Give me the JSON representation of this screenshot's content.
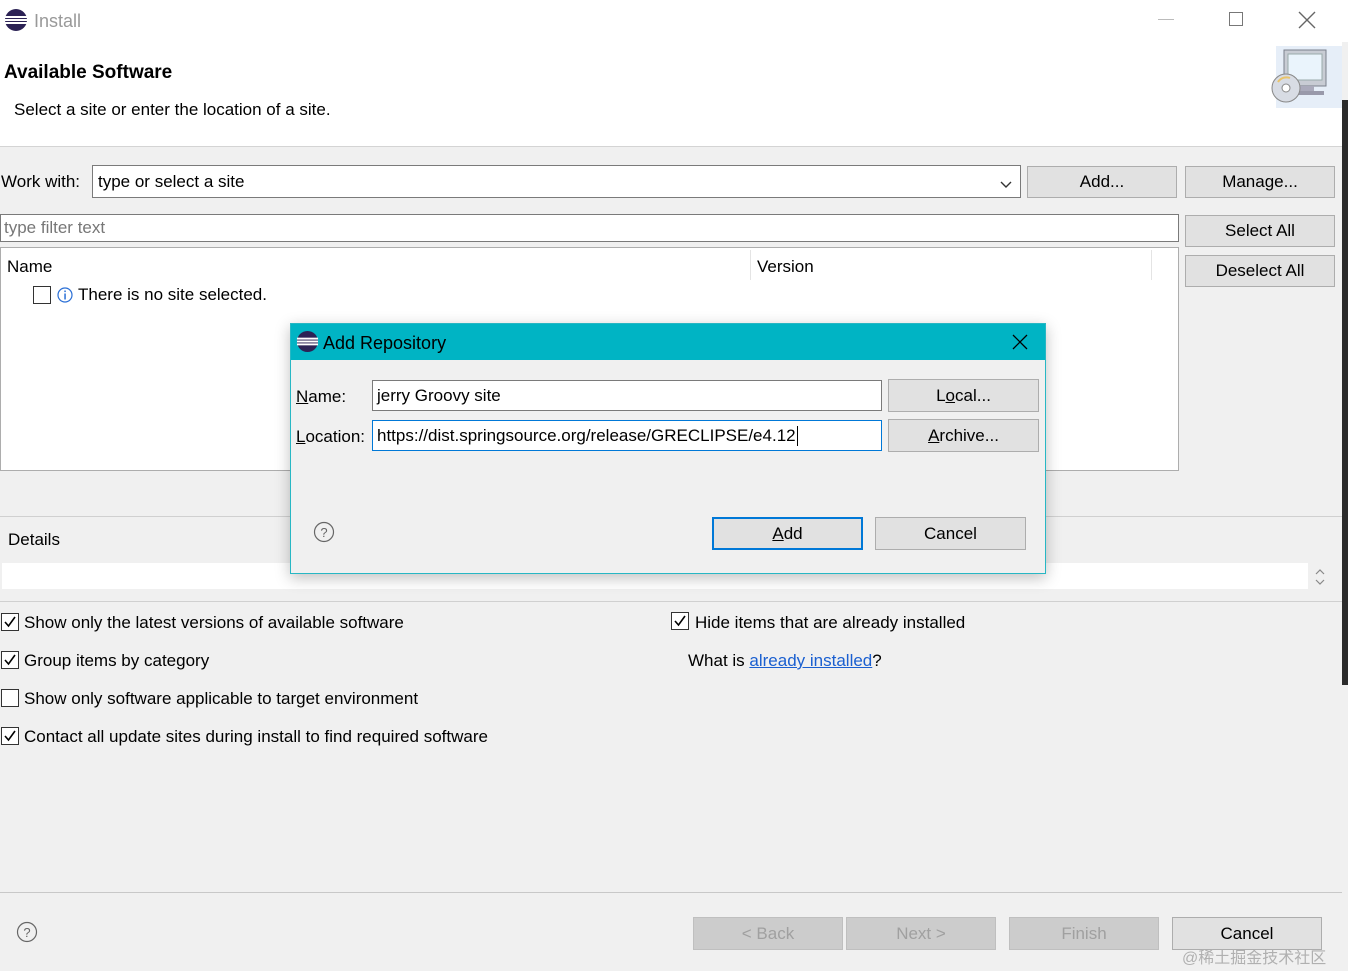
{
  "window": {
    "title": "Install"
  },
  "header": {
    "title": "Available Software",
    "subtitle": "Select a site or enter the location of a site."
  },
  "work_with": {
    "label": "Work with:",
    "placeholder": "type or select a site",
    "add_button": "Add...",
    "manage_button": "Manage..."
  },
  "filter": {
    "placeholder": "type filter text"
  },
  "side_buttons": {
    "select_all": "Select All",
    "deselect_all": "Deselect All"
  },
  "table": {
    "columns": [
      "Name",
      "Version"
    ],
    "rows": [
      {
        "checked": false,
        "text": "There is no site selected."
      }
    ]
  },
  "details": {
    "label": "Details"
  },
  "options": {
    "show_latest": {
      "label": "Show only the latest versions of available software",
      "checked": true
    },
    "group_by_category": {
      "label": "Group items by category",
      "checked": true
    },
    "show_applicable": {
      "label": "Show only software applicable to target environment",
      "checked": false
    },
    "contact_all": {
      "label": "Contact all update sites during install to find required software",
      "checked": true
    },
    "hide_installed": {
      "label": "Hide items that are already installed",
      "checked": true
    },
    "what_is_prefix": "What is ",
    "what_is_link": "already installed",
    "what_is_suffix": "?"
  },
  "footer": {
    "back": "< Back",
    "next": "Next >",
    "finish": "Finish",
    "cancel": "Cancel"
  },
  "watermark": "@稀土掘金技术社区",
  "dialog": {
    "title": "Add Repository",
    "name_label_u": "N",
    "name_label_rest": "ame:",
    "name_value": "jerry Groovy site",
    "local_pre": "L",
    "local_u": "o",
    "local_post": "cal...",
    "location_label_u": "L",
    "location_label_rest": "ocation:",
    "location_value": "https://dist.springsource.org/release/GRECLIPSE/e4.12",
    "archive_u": "A",
    "archive_rest": "rchive...",
    "add_u": "A",
    "add_rest": "dd",
    "cancel": "Cancel",
    "title_bar_color": "#00b4c4"
  }
}
